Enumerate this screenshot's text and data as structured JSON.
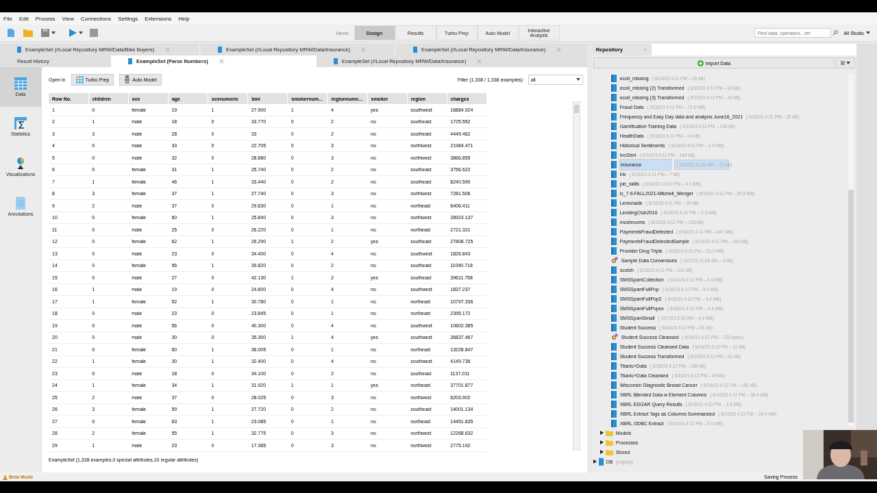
{
  "menu": [
    "File",
    "Edit",
    "Process",
    "View",
    "Connections",
    "Settings",
    "Extensions",
    "Help"
  ],
  "toolbar": {
    "views_label": "Views:",
    "views": [
      {
        "label": "Design",
        "selected": true
      },
      {
        "label": "Results",
        "selected": false
      },
      {
        "label": "Turbo Prep",
        "selected": false
      },
      {
        "label": "Auto Model",
        "selected": false
      },
      {
        "label": "Interactive Analysis",
        "selected": false
      }
    ],
    "search": {
      "placeholder": "Find data, operators...etc"
    },
    "studio": "All Studio"
  },
  "editor_tabs_row1": [
    {
      "label": "ExampleSet (//Local Repository MRW/Data/Bike Buyers)",
      "selected": false
    },
    {
      "label": "ExampleSet (//Local Repository MRW/Data/Insurance)",
      "selected": false
    },
    {
      "label": "ExampleSet (//Local Repository MRW/Data/Insurance)",
      "selected": false
    }
  ],
  "editor_tabs_row2": [
    {
      "label": "Result History",
      "kind": "history",
      "selected": false
    },
    {
      "label": "ExampleSet (Parse Numbers)",
      "kind": "data",
      "selected": true
    },
    {
      "label": "ExampleSet (//Local Repository MRW/Data/Insurance)",
      "kind": "data",
      "selected": false
    }
  ],
  "sidebar": [
    {
      "label": "Data",
      "kind": "data",
      "selected": true
    },
    {
      "label": "Statistics",
      "kind": "statistics",
      "selected": false
    },
    {
      "label": "Visualizations",
      "kind": "visualizations",
      "selected": false
    },
    {
      "label": "Annotations",
      "kind": "annotations",
      "selected": false
    }
  ],
  "open_in": {
    "label": "Open in",
    "buttons": [
      {
        "label": "Turbo Prep",
        "kind": "turbo"
      },
      {
        "label": "Auto Model",
        "kind": "auto"
      }
    ]
  },
  "filter": {
    "label": "Filter (1,338 / 1,338 examples):",
    "value": "all"
  },
  "table": {
    "columns": [
      "Row No.",
      "children",
      "sex",
      "age",
      "sexnumeric",
      "bmi",
      "smokernum...",
      "regionnume...",
      "smoker",
      "region",
      "charges"
    ],
    "rows": [
      [
        "1",
        "0",
        "female",
        "19",
        "1",
        "27.900",
        "1",
        "4",
        "yes",
        "southwest",
        "16884.924"
      ],
      [
        "2",
        "1",
        "male",
        "18",
        "0",
        "33.770",
        "0",
        "2",
        "no",
        "southeast",
        "1725.552"
      ],
      [
        "3",
        "3",
        "male",
        "28",
        "0",
        "33",
        "0",
        "2",
        "no",
        "southeast",
        "4449.462"
      ],
      [
        "4",
        "0",
        "male",
        "33",
        "0",
        "22.705",
        "0",
        "3",
        "no",
        "northwest",
        "21984.471"
      ],
      [
        "5",
        "0",
        "male",
        "32",
        "0",
        "28.880",
        "0",
        "3",
        "no",
        "northwest",
        "3866.855"
      ],
      [
        "6",
        "0",
        "female",
        "31",
        "1",
        "25.740",
        "0",
        "2",
        "no",
        "southeast",
        "3756.622"
      ],
      [
        "7",
        "1",
        "female",
        "46",
        "1",
        "33.440",
        "0",
        "2",
        "no",
        "southeast",
        "8240.590"
      ],
      [
        "8",
        "3",
        "female",
        "37",
        "1",
        "27.740",
        "0",
        "3",
        "no",
        "northwest",
        "7281.506"
      ],
      [
        "9",
        "2",
        "male",
        "37",
        "0",
        "29.830",
        "0",
        "1",
        "no",
        "northeast",
        "6406.411"
      ],
      [
        "10",
        "0",
        "female",
        "60",
        "1",
        "25.840",
        "0",
        "3",
        "no",
        "northwest",
        "28923.137"
      ],
      [
        "11",
        "0",
        "male",
        "25",
        "0",
        "26.220",
        "0",
        "1",
        "no",
        "northeast",
        "2721.321"
      ],
      [
        "12",
        "0",
        "female",
        "62",
        "1",
        "26.290",
        "1",
        "2",
        "yes",
        "southeast",
        "27808.725"
      ],
      [
        "13",
        "0",
        "male",
        "23",
        "0",
        "34.400",
        "0",
        "4",
        "no",
        "southwest",
        "1826.843"
      ],
      [
        "14",
        "0",
        "female",
        "56",
        "1",
        "39.820",
        "0",
        "2",
        "no",
        "southeast",
        "11090.718"
      ],
      [
        "15",
        "0",
        "male",
        "27",
        "0",
        "42.130",
        "1",
        "2",
        "yes",
        "southeast",
        "39611.758"
      ],
      [
        "16",
        "1",
        "male",
        "19",
        "0",
        "24.600",
        "0",
        "4",
        "no",
        "southwest",
        "1837.237"
      ],
      [
        "17",
        "1",
        "female",
        "52",
        "1",
        "30.780",
        "0",
        "1",
        "no",
        "northeast",
        "10797.336"
      ],
      [
        "18",
        "0",
        "male",
        "23",
        "0",
        "23.845",
        "0",
        "1",
        "no",
        "northeast",
        "2395.172"
      ],
      [
        "19",
        "0",
        "male",
        "56",
        "0",
        "40.300",
        "0",
        "4",
        "no",
        "southwest",
        "10602.385"
      ],
      [
        "20",
        "0",
        "male",
        "30",
        "0",
        "35.300",
        "1",
        "4",
        "yes",
        "southwest",
        "36837.467"
      ],
      [
        "21",
        "0",
        "female",
        "60",
        "1",
        "36.005",
        "0",
        "1",
        "no",
        "northeast",
        "13228.847"
      ],
      [
        "22",
        "1",
        "female",
        "30",
        "1",
        "32.400",
        "0",
        "4",
        "no",
        "southwest",
        "4149.736"
      ],
      [
        "23",
        "0",
        "male",
        "18",
        "0",
        "34.100",
        "0",
        "2",
        "no",
        "southeast",
        "1137.011"
      ],
      [
        "24",
        "1",
        "female",
        "34",
        "1",
        "31.920",
        "1",
        "1",
        "yes",
        "northeast",
        "37701.877"
      ],
      [
        "25",
        "2",
        "male",
        "37",
        "0",
        "28.025",
        "0",
        "3",
        "no",
        "northwest",
        "6203.902"
      ],
      [
        "26",
        "3",
        "female",
        "59",
        "1",
        "27.720",
        "0",
        "2",
        "no",
        "southeast",
        "14001.134"
      ],
      [
        "27",
        "0",
        "female",
        "63",
        "1",
        "23.085",
        "0",
        "1",
        "no",
        "northeast",
        "14451.835"
      ],
      [
        "28",
        "2",
        "female",
        "55",
        "1",
        "32.775",
        "0",
        "3",
        "no",
        "northwest",
        "12268.632"
      ],
      [
        "29",
        "1",
        "male",
        "23",
        "0",
        "17.385",
        "0",
        "3",
        "no",
        "northwest",
        "2775.192"
      ]
    ]
  },
  "table_summary": "ExampleSet (1,338 examples,0 special attributes,10 regular attributes)",
  "repository": {
    "tab": "Repository",
    "import_button": "Import Data",
    "items": [
      {
        "name": "ecoli_missing",
        "meta": "( 6/16/23 4:11 PM – 26 kB)",
        "kind": "data",
        "selected": false
      },
      {
        "name": "ecoli_missing (2) Transformed",
        "meta": "( 6/16/23 4:11 PM – 30 kB)",
        "kind": "data",
        "selected": false
      },
      {
        "name": "ecoli_missing (3) Transformed",
        "meta": "( 6/16/23 4:11 PM – 30 kB)",
        "kind": "data",
        "selected": false
      },
      {
        "name": "Fraud Data",
        "meta": "( 6/16/23 4:11 PM – 70.6 MB)",
        "kind": "data",
        "selected": false
      },
      {
        "name": "Frequency and Easy Day data and analysis June16_2021",
        "meta": "( 6/16/23 4:11 PM – 25 kB)",
        "kind": "data",
        "selected": false
      },
      {
        "name": "Gamification Training Data",
        "meta": "( 6/16/23 4:11 PM – 138 kB)",
        "kind": "data",
        "selected": false
      },
      {
        "name": "HealthData",
        "meta": "( 6/16/23 4:11 PM – 14 kB)",
        "kind": "data",
        "selected": false
      },
      {
        "name": "Historical Sentiments",
        "meta": "( 6/16/23 4:11 PM – 1.9 MB)",
        "kind": "data",
        "selected": false
      },
      {
        "name": "IncStmt",
        "meta": "( 6/16/23 4:11 PM – 164 kB)",
        "kind": "data",
        "selected": false
      },
      {
        "name": "Insurance",
        "meta": "( 10/7/23 11:02 AM – 72 kB)",
        "kind": "data",
        "selected": true
      },
      {
        "name": "iris",
        "meta": "( 6/16/23 4:11 PM – 7 kB)",
        "kind": "data",
        "selected": false
      },
      {
        "name": "job_skills",
        "meta": "( 6/16/23 10:00 PM – 4.1 MB)",
        "kind": "data",
        "selected": false
      },
      {
        "name": "lc_7.9-FALL2021-Mitchell_Wenger",
        "meta": "( 6/16/23 4:11 PM – 25.5 MB)",
        "kind": "data",
        "selected": false
      },
      {
        "name": "Lemonade",
        "meta": "( 6/16/23 4:11 PM – 20 kB)",
        "kind": "data",
        "selected": false
      },
      {
        "name": "LendingClub2016",
        "meta": "( 6/16/23 4:11 PM – 2.3 MB)",
        "kind": "data",
        "selected": false
      },
      {
        "name": "mushrooms",
        "meta": "( 6/16/23 4:11 PM – 195 kB)",
        "kind": "data",
        "selected": false
      },
      {
        "name": "PaymentsFraudDetected",
        "meta": "( 6/16/23 4:11 PM – 447 MB)",
        "kind": "data",
        "selected": false
      },
      {
        "name": "PaymentsFraudDetectedSample",
        "meta": "( 6/16/23 4:11 PM – 104 kB)",
        "kind": "data",
        "selected": false
      },
      {
        "name": "Provider Drug Triple",
        "meta": "( 6/16/23 4:11 PM – 13.3 MB)",
        "kind": "data",
        "selected": false
      },
      {
        "name": "Sample Data Conversions",
        "meta": "( 10/7/23 11:06 AM – 2 kB)",
        "kind": "process",
        "selected": false
      },
      {
        "name": "scotch",
        "meta": "( 6/16/23 4:11 PM – 101 kB)",
        "kind": "data",
        "selected": false
      },
      {
        "name": "SMSSpamCollection",
        "meta": "( 6/16/23 4:11 PM – 4.5 MB)",
        "kind": "data",
        "selected": false
      },
      {
        "name": "SMSSpamFullPop",
        "meta": "( 6/16/23 4:12 PM – 4.4 MB)",
        "kind": "data",
        "selected": false
      },
      {
        "name": "SMSSpamFullPop2",
        "meta": "( 6/16/23 4:12 PM – 4.4 MB)",
        "kind": "data",
        "selected": false
      },
      {
        "name": "SMSSpamFullPopxx",
        "meta": "( 6/16/23 4:12 PM – 4.4 MB)",
        "kind": "data",
        "selected": false
      },
      {
        "name": "SMSSpamSmall",
        "meta": "( 10/7/23 3:30 AM – 4.4 MB)",
        "kind": "data",
        "selected": false
      },
      {
        "name": "Student Success",
        "meta": "( 6/16/23 4:12 PM – 51 kB)",
        "kind": "data",
        "selected": false
      },
      {
        "name": "Student Success Cleansed",
        "meta": "( 6/16/23 4:12 PM – 733 bytes)",
        "kind": "process",
        "selected": false
      },
      {
        "name": "Student Success Cleansed Data",
        "meta": "( 6/16/23 4:12 PM – 31 kB)",
        "kind": "data",
        "selected": false
      },
      {
        "name": "Student Success Transformed",
        "meta": "( 6/16/23 4:12 PM – 51 kB)",
        "kind": "data",
        "selected": false
      },
      {
        "name": "Titanic+Data",
        "meta": "( 6/16/23 4:12 PM – 185 kB)",
        "kind": "data",
        "selected": false
      },
      {
        "name": "Titanic+Data Cleansed",
        "meta": "( 6/16/23 4:12 PM – 49 kB)",
        "kind": "data",
        "selected": false
      },
      {
        "name": "Wisconsin Diagnostic Breast Cancer",
        "meta": "( 6/16/23 4:12 PM – 152 kB)",
        "kind": "data",
        "selected": false
      },
      {
        "name": "XBRL Blended Data w Element Columns",
        "meta": "( 6/16/23 4:12 PM – 30.4 MB)",
        "kind": "data",
        "selected": false
      },
      {
        "name": "XBRL EDGAR Query Results",
        "meta": "( 6/16/23 4:12 PM – 3.8 MB)",
        "kind": "data",
        "selected": false
      },
      {
        "name": "XBRL Extract Tags as Columns Summarized",
        "meta": "( 6/16/23 4:12 PM – 20.4 MB)",
        "kind": "data",
        "selected": false
      },
      {
        "name": "XBRL ODBC Extract",
        "meta": "( 6/16/23 4:12 PM – 5.0 MB)",
        "kind": "data",
        "selected": false
      }
    ],
    "folders": [
      {
        "name": "Models",
        "kind": "folder",
        "expanded": false
      },
      {
        "name": "Processes",
        "kind": "folder",
        "expanded": false
      },
      {
        "name": "Stored",
        "kind": "folder",
        "expanded": false
      },
      {
        "name": "DB",
        "note": "(Legacy)",
        "kind": "database",
        "expanded": false
      }
    ]
  },
  "status": {
    "mode": "Beta Mode",
    "right": "Saving Process"
  }
}
